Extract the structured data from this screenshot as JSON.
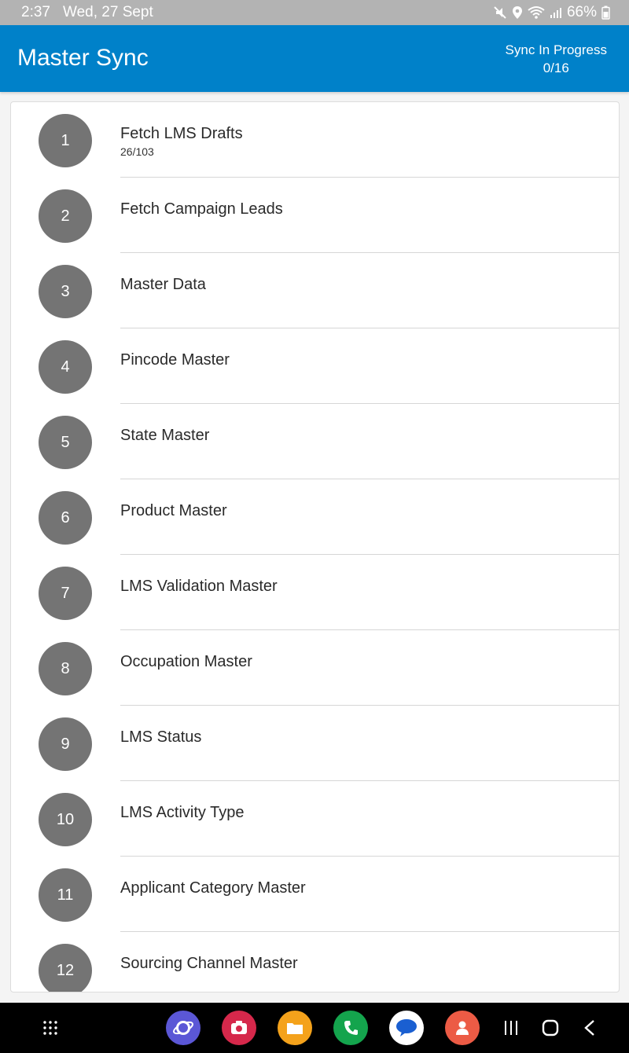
{
  "status_bar": {
    "time": "2:37",
    "date": "Wed, 27 Sept",
    "battery": "66%",
    "icons": [
      "mute-icon",
      "location-icon",
      "wifi-icon",
      "signal-icon",
      "battery-icon"
    ]
  },
  "app_bar": {
    "title": "Master Sync",
    "sync_status": "Sync In Progress",
    "sync_count": "0/16",
    "background_color": "#0081c9"
  },
  "sync_items": [
    {
      "number": "1",
      "label": "Fetch LMS Drafts",
      "progress": "26/103"
    },
    {
      "number": "2",
      "label": "Fetch Campaign Leads"
    },
    {
      "number": "3",
      "label": "Master Data"
    },
    {
      "number": "4",
      "label": "Pincode Master"
    },
    {
      "number": "5",
      "label": "State Master"
    },
    {
      "number": "6",
      "label": "Product Master"
    },
    {
      "number": "7",
      "label": "LMS Validation Master"
    },
    {
      "number": "8",
      "label": "Occupation Master"
    },
    {
      "number": "9",
      "label": "LMS Status"
    },
    {
      "number": "10",
      "label": "LMS Activity Type"
    },
    {
      "number": "11",
      "label": "Applicant Category Master"
    },
    {
      "number": "12",
      "label": "Sourcing Channel Master"
    }
  ],
  "nav_bar": {
    "items": [
      "app-drawer-icon",
      "browser-app-icon",
      "camera-app-icon",
      "files-app-icon",
      "phone-app-icon",
      "messages-app-icon",
      "contacts-app-icon",
      "recents-icon",
      "home-icon",
      "back-icon"
    ]
  }
}
